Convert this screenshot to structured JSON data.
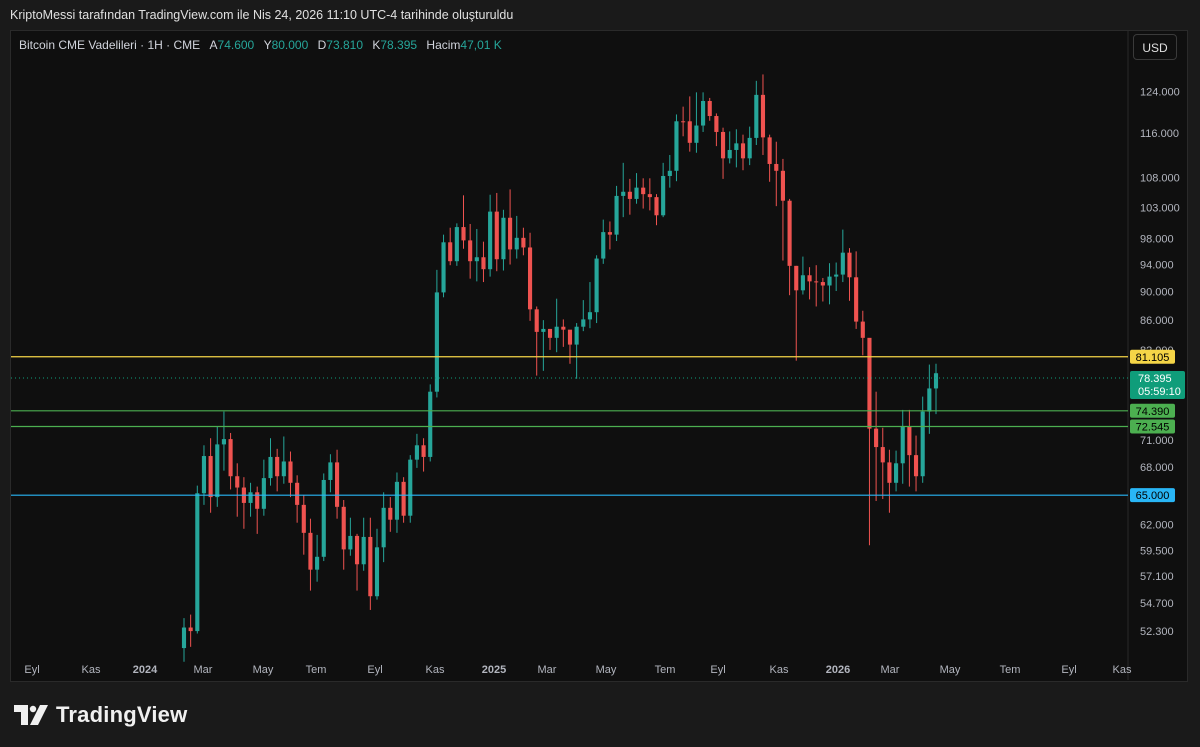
{
  "caption": "KriptoMessi tarafından TradingView.com ile Nis 24, 2026 11:10 UTC-4 tarihinde oluşturuldu",
  "legend": {
    "symbol": "Bitcoin CME Vadelileri · 1H · CME",
    "open_label": "A",
    "open": "74.600",
    "high_label": "Y",
    "high": "80.000",
    "low_label": "D",
    "low": "73.810",
    "close_label": "K",
    "close": "78.395",
    "volume_label": "Hacim",
    "volume": "47,01 K"
  },
  "currency": "USD",
  "brand": "TradingView",
  "countdown": "05:59:10",
  "colors": {
    "up": "#26a69a",
    "down": "#ef5350",
    "yellow": "#f5d547",
    "green": "#4caf50",
    "cyan": "#29b6f6",
    "price": "#0f9d7a"
  },
  "chart_data": {
    "type": "candlestick",
    "y_scale": "log",
    "ylim": [
      50500,
      131000
    ],
    "y_ticks": [
      52300,
      54700,
      57100,
      59500,
      62000,
      65000,
      68000,
      71000,
      74390,
      78395,
      82000,
      86000,
      90000,
      94000,
      98000,
      103000,
      108000,
      116000,
      124000
    ],
    "y_tick_labels": [
      "52.300",
      "54.700",
      "57.100",
      "59.500",
      "62.000",
      "65.000",
      "68.000",
      "71.000",
      "74.390",
      "78.395",
      "82.000",
      "86.000",
      "90.000",
      "94.000",
      "98.000",
      "103.000",
      "108.000",
      "116.000",
      "124.000"
    ],
    "x_ticks": [
      "Eyl",
      "Kas",
      "2024",
      "Mar",
      "May",
      "Tem",
      "Eyl",
      "Kas",
      "2025",
      "Mar",
      "May",
      "Tem",
      "Eyl",
      "Kas",
      "2026",
      "Mar",
      "May",
      "Tem",
      "Eyl",
      "Kas"
    ],
    "x_start": "2024-02-05",
    "horizontal_lines": [
      {
        "label": "81.105",
        "value": 81105,
        "color": "yellow"
      },
      {
        "label": "74.390",
        "value": 74390,
        "color": "green"
      },
      {
        "label": "72.545",
        "value": 72545,
        "color": "green"
      },
      {
        "label": "65.000",
        "value": 65000,
        "color": "cyan"
      }
    ],
    "last_price": {
      "label": "78.395",
      "value": 78395
    },
    "candles": [
      [
        50900,
        52600,
        49800,
        53400
      ],
      [
        52600,
        52300,
        51000,
        53700
      ],
      [
        52300,
        65200,
        52100,
        66000
      ],
      [
        65200,
        69200,
        64000,
        70400
      ],
      [
        69200,
        64800,
        63200,
        71200
      ],
      [
        64800,
        70500,
        63800,
        72600
      ],
      [
        70500,
        71100,
        67600,
        74300
      ],
      [
        71100,
        67000,
        65600,
        71800
      ],
      [
        67000,
        65800,
        62800,
        68400
      ],
      [
        65800,
        64200,
        61600,
        66900
      ],
      [
        64200,
        65300,
        62800,
        66300
      ],
      [
        65300,
        63600,
        61100,
        65900
      ],
      [
        63600,
        66800,
        62900,
        68800
      ],
      [
        66800,
        69100,
        66000,
        71200
      ],
      [
        69100,
        67000,
        65400,
        70000
      ],
      [
        67000,
        68600,
        66200,
        71400
      ],
      [
        68600,
        66300,
        64800,
        69700
      ],
      [
        66300,
        64000,
        62200,
        67100
      ],
      [
        64000,
        61200,
        59100,
        65000
      ],
      [
        61200,
        57700,
        55800,
        62600
      ],
      [
        57700,
        58900,
        56600,
        61000
      ],
      [
        58900,
        66600,
        58500,
        67300
      ],
      [
        66600,
        68500,
        65300,
        69400
      ],
      [
        68500,
        63800,
        62600,
        69900
      ],
      [
        63800,
        59600,
        57700,
        64500
      ],
      [
        59600,
        60900,
        59000,
        62700
      ],
      [
        60900,
        58200,
        55800,
        61100
      ],
      [
        58200,
        60800,
        57600,
        62700
      ],
      [
        60800,
        55300,
        54100,
        62700
      ],
      [
        55300,
        59800,
        55000,
        61600
      ],
      [
        59800,
        63700,
        58400,
        65300
      ],
      [
        63700,
        62500,
        61300,
        64800
      ],
      [
        62500,
        66400,
        61200,
        67400
      ],
      [
        66400,
        62900,
        62200,
        66900
      ],
      [
        62900,
        68800,
        62200,
        69300
      ],
      [
        68800,
        70400,
        67900,
        71700
      ],
      [
        70400,
        69100,
        67500,
        71200
      ],
      [
        69100,
        76700,
        68600,
        77600
      ],
      [
        76700,
        89900,
        76000,
        93200
      ],
      [
        89900,
        97400,
        89200,
        98600
      ],
      [
        97400,
        94500,
        93900,
        99700
      ],
      [
        94500,
        99800,
        93800,
        100400
      ],
      [
        99800,
        97700,
        96400,
        105000
      ],
      [
        97700,
        94500,
        91900,
        100300
      ],
      [
        94500,
        95100,
        91500,
        99500
      ],
      [
        95100,
        93300,
        91400,
        97500
      ],
      [
        93300,
        102300,
        92200,
        105100
      ],
      [
        102300,
        94800,
        93000,
        105400
      ],
      [
        94800,
        101300,
        93100,
        102600
      ],
      [
        101300,
        96300,
        94000,
        106000
      ],
      [
        96300,
        98100,
        94900,
        101600
      ],
      [
        98100,
        96600,
        95400,
        99700
      ],
      [
        96600,
        87500,
        85900,
        98900
      ],
      [
        87500,
        84400,
        78700,
        87900
      ],
      [
        84400,
        84800,
        79300,
        86000
      ],
      [
        84800,
        83600,
        82000,
        84800
      ],
      [
        83600,
        85100,
        81700,
        89000
      ],
      [
        85100,
        84700,
        82400,
        86100
      ],
      [
        84700,
        82700,
        80200,
        84400
      ],
      [
        82700,
        85100,
        78300,
        85600
      ],
      [
        85100,
        86100,
        84500,
        88800
      ],
      [
        86100,
        87100,
        84900,
        91400
      ],
      [
        87100,
        94900,
        85600,
        95400
      ],
      [
        94900,
        99000,
        94100,
        101000
      ],
      [
        99000,
        98600,
        96300,
        100700
      ],
      [
        98600,
        104900,
        97600,
        106600
      ],
      [
        104900,
        105600,
        101400,
        110600
      ],
      [
        105600,
        104400,
        101800,
        107800
      ],
      [
        104400,
        106300,
        103600,
        108800
      ],
      [
        106300,
        105200,
        102800,
        107900
      ],
      [
        105200,
        104700,
        102500,
        107900
      ],
      [
        104700,
        101700,
        100100,
        105200
      ],
      [
        101700,
        108300,
        101400,
        110600
      ],
      [
        108300,
        109200,
        106300,
        112000
      ],
      [
        109200,
        118200,
        107400,
        119500
      ],
      [
        118200,
        118100,
        115400,
        121000
      ],
      [
        118200,
        114200,
        112600,
        123000
      ],
      [
        114200,
        117400,
        112400,
        123800
      ],
      [
        117400,
        122100,
        116200,
        123800
      ],
      [
        122100,
        119200,
        118300,
        122700
      ],
      [
        119200,
        116200,
        113600,
        119700
      ],
      [
        116200,
        111400,
        107800,
        117000
      ],
      [
        111400,
        112900,
        110500,
        116300
      ],
      [
        112900,
        114100,
        109800,
        116700
      ],
      [
        114100,
        111400,
        109300,
        115700
      ],
      [
        111400,
        115100,
        110200,
        117200
      ],
      [
        115100,
        123300,
        113800,
        126100
      ],
      [
        123300,
        115200,
        112000,
        127400
      ],
      [
        115200,
        110400,
        107300,
        115700
      ],
      [
        110400,
        109200,
        103200,
        114400
      ],
      [
        109200,
        104100,
        94600,
        111300
      ],
      [
        104100,
        93800,
        89500,
        104400
      ],
      [
        93800,
        90200,
        80600,
        93800
      ],
      [
        90200,
        92400,
        89600,
        95200
      ],
      [
        92400,
        91500,
        88900,
        93600
      ],
      [
        91500,
        91400,
        87900,
        93900
      ],
      [
        91400,
        90900,
        88600,
        92000
      ],
      [
        90900,
        92200,
        88200,
        94200
      ],
      [
        92200,
        92500,
        90100,
        94300
      ],
      [
        92500,
        95800,
        91400,
        99400
      ],
      [
        95800,
        92100,
        88700,
        96500
      ],
      [
        92100,
        85800,
        84800,
        96000
      ],
      [
        85800,
        83600,
        81300,
        87300
      ],
      [
        83600,
        72300,
        60000,
        79100
      ],
      [
        72300,
        70200,
        64400,
        76700
      ],
      [
        70200,
        68500,
        64600,
        72400
      ],
      [
        68500,
        66300,
        63200,
        69900
      ],
      [
        66300,
        68400,
        65400,
        69800
      ],
      [
        68400,
        72500,
        66200,
        74500
      ],
      [
        72500,
        69300,
        65900,
        74500
      ],
      [
        69300,
        67000,
        65400,
        71500
      ],
      [
        67000,
        74300,
        66300,
        76100
      ],
      [
        74300,
        77100,
        71700,
        80100
      ],
      [
        77100,
        79000,
        74000,
        80200
      ]
    ]
  }
}
